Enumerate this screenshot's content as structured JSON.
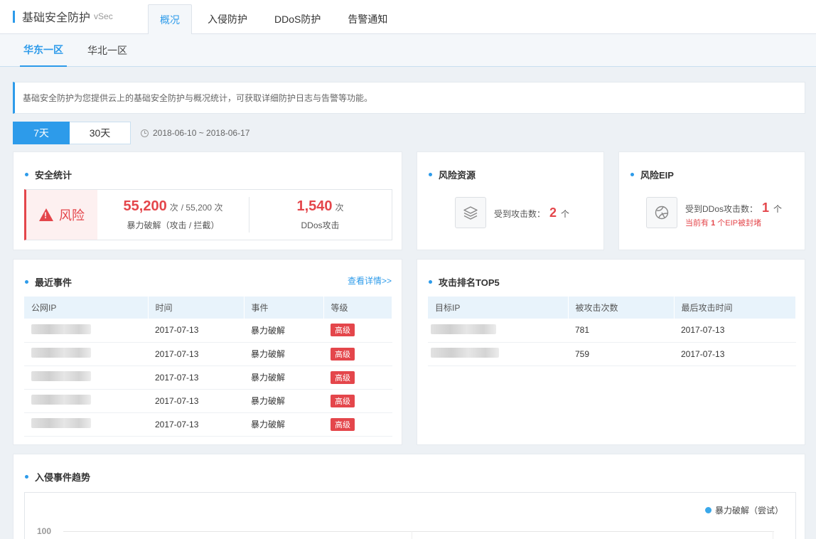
{
  "header": {
    "title": "基础安全防护",
    "subtitle": "vSec",
    "tabs": [
      {
        "label": "概况",
        "active": true
      },
      {
        "label": "入侵防护",
        "active": false
      },
      {
        "label": "DDoS防护",
        "active": false
      },
      {
        "label": "告警通知",
        "active": false
      }
    ]
  },
  "regions": [
    {
      "label": "华东一区",
      "active": true
    },
    {
      "label": "华北一区",
      "active": false
    }
  ],
  "banner": "基础安全防护为您提供云上的基础安全防护与概况统计，可获取详细防护日志与告警等功能。",
  "range": {
    "options": [
      "7天",
      "30天"
    ],
    "selected": "7天",
    "dates": "2018-06-10 ~ 2018-06-17"
  },
  "security_stats": {
    "title": "安全统计",
    "risk_label": "风险",
    "brute_value": "55,200",
    "brute_unit": "次",
    "brute_total": "/ 55,200 次",
    "brute_label": "暴力破解（攻击 / 拦截）",
    "ddos_value": "1,540",
    "ddos_unit": "次",
    "ddos_label": "DDos攻击"
  },
  "risk_resource": {
    "title": "风险资源",
    "text": "受到攻击数：",
    "count": "2",
    "unit": "个",
    "icon": "layers-icon"
  },
  "risk_eip": {
    "title": "风险EIP",
    "text": "受到DDos攻击数：",
    "count": "1",
    "unit": "个",
    "warn_prefix": "当前有",
    "warn_count": "1",
    "warn_suffix": "个EIP被封堵",
    "icon": "globe-icon"
  },
  "recent_events": {
    "title": "最近事件",
    "more": "查看详情>>",
    "columns": [
      "公网IP",
      "时间",
      "事件",
      "等级"
    ],
    "rows": [
      {
        "time": "2017-07-13",
        "event": "暴力破解",
        "level": "高级"
      },
      {
        "time": "2017-07-13",
        "event": "暴力破解",
        "level": "高级"
      },
      {
        "time": "2017-07-13",
        "event": "暴力破解",
        "level": "高级"
      },
      {
        "time": "2017-07-13",
        "event": "暴力破解",
        "level": "高级"
      },
      {
        "time": "2017-07-13",
        "event": "暴力破解",
        "level": "高级"
      }
    ]
  },
  "top5": {
    "title": "攻击排名TOP5",
    "columns": [
      "目标IP",
      "被攻击次数",
      "最后攻击时间"
    ],
    "rows": [
      {
        "count": "781",
        "time": "2017-07-13"
      },
      {
        "count": "759",
        "time": "2017-07-13"
      }
    ]
  },
  "trend": {
    "title": "入侵事件趋势",
    "legend": "暴力破解（尝试）",
    "ytick": "100",
    "color": "#3aa8ea"
  }
}
